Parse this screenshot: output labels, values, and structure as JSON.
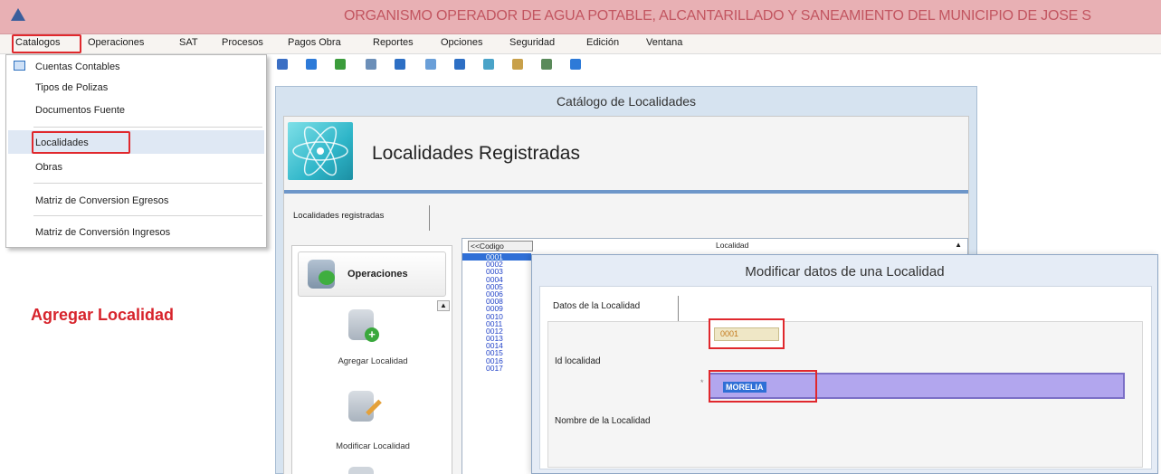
{
  "window": {
    "title": "ORGANISMO OPERADOR DE AGUA POTABLE, ALCANTARILLADO Y SANEAMIENTO DEL MUNICIPIO DE JOSE S"
  },
  "menubar": {
    "items": [
      {
        "label": "Catalogos"
      },
      {
        "label": "Operaciones"
      },
      {
        "label": "SAT"
      },
      {
        "label": "Procesos"
      },
      {
        "label": "Pagos Obra"
      },
      {
        "label": "Reportes"
      },
      {
        "label": "Opciones"
      },
      {
        "label": "Seguridad"
      },
      {
        "label": "Edición"
      },
      {
        "label": "Ventana"
      }
    ]
  },
  "dropdown": {
    "items": [
      {
        "label": "Cuentas Contables"
      },
      {
        "label": "Tipos de Polizas"
      },
      {
        "label": "Documentos Fuente"
      },
      {
        "label": "Localidades"
      },
      {
        "label": "Obras"
      },
      {
        "label": "Matriz de Conversion Egresos"
      },
      {
        "label": "Matriz de Conversión Ingresos"
      }
    ]
  },
  "annotation": {
    "label": "Agregar Localidad"
  },
  "catalog_window": {
    "title": "Catálogo de Localidades",
    "banner_title": "Localidades Registradas",
    "tab_label": "Localidades registradas",
    "operations": {
      "header": "Operaciones",
      "add_label": "Agregar Localidad",
      "modify_label": "Modificar Localidad"
    },
    "grid": {
      "code_header": "<<Codigo",
      "location_header": "Localidad",
      "codes": [
        "0001",
        "0002",
        "0003",
        "0004",
        "0005",
        "0006",
        "0008",
        "0009",
        "0010",
        "0011",
        "0012",
        "0013",
        "0014",
        "0015",
        "0016",
        "0017"
      ]
    }
  },
  "modal": {
    "title": "Modificar datos de una Localidad",
    "tab_label": "Datos de la Localidad",
    "id_label": "Id localidad",
    "id_value": "0001",
    "name_label": "Nombre de la Localidad",
    "name_value": "MORELIA"
  },
  "colors": {
    "title_bar": "#e8b0b4",
    "annotation_red": "#d7242c",
    "selection_blue": "#2f6fd6",
    "name_field": "#b2a6ee"
  }
}
